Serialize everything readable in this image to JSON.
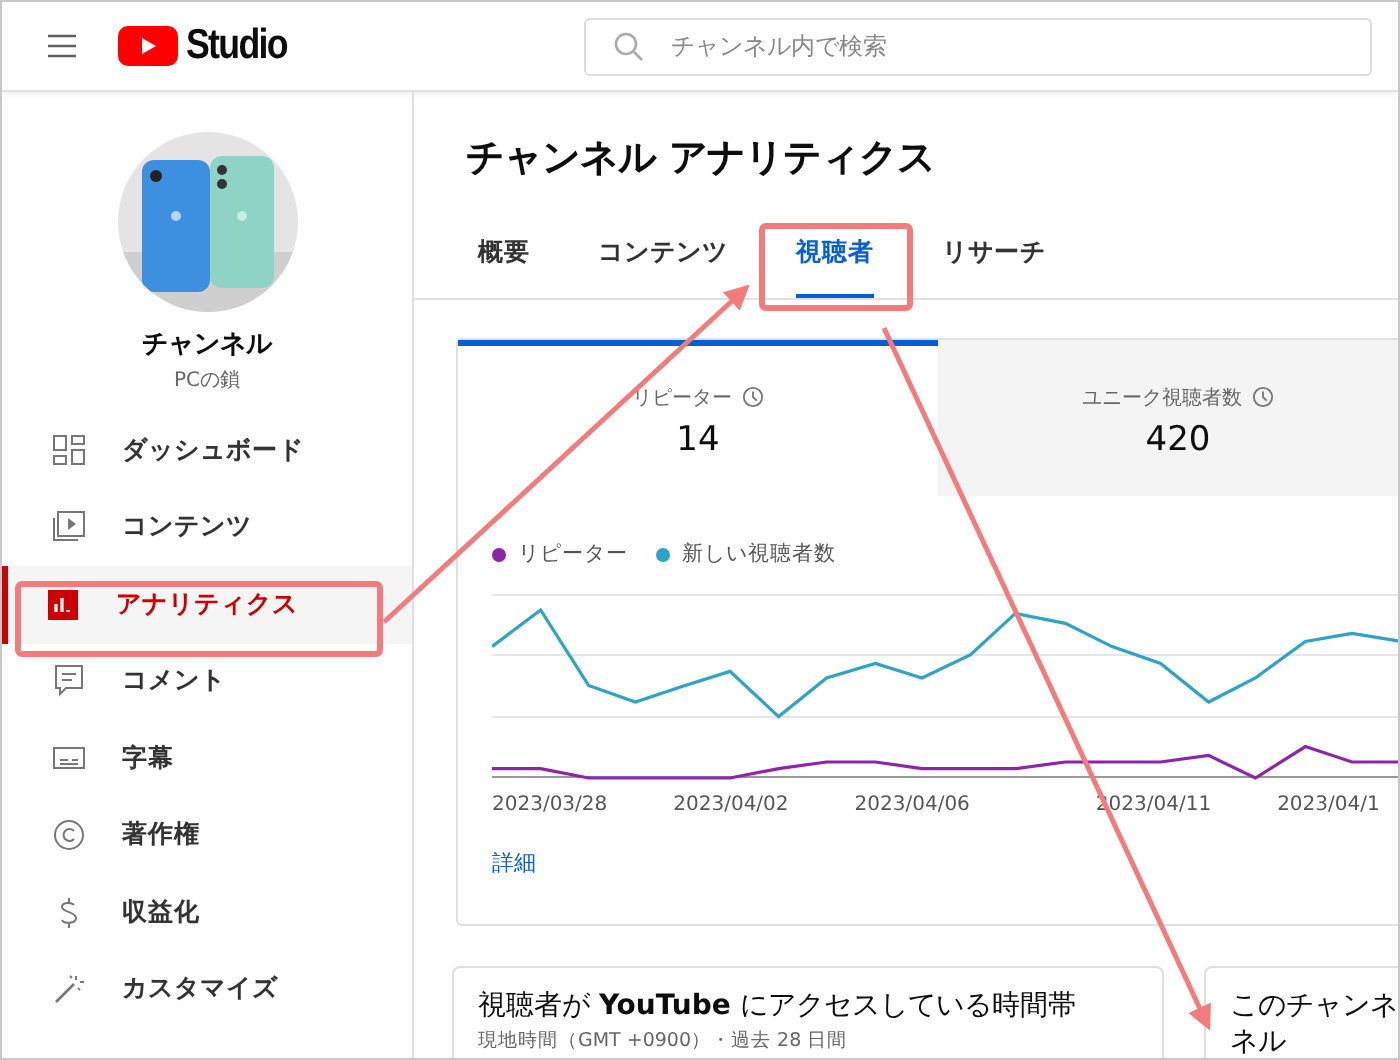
{
  "header": {
    "logo_text": "Studio",
    "search": {
      "placeholder": "チャンネル内で検索"
    }
  },
  "channel": {
    "name": "チャンネル",
    "subtitle": "PCの鎖"
  },
  "sidebar": {
    "items": [
      {
        "label": "ダッシュボード",
        "selected": false
      },
      {
        "label": "コンテンツ",
        "selected": false
      },
      {
        "label": "アナリティクス",
        "selected": true
      },
      {
        "label": "コメント",
        "selected": false
      },
      {
        "label": "字幕",
        "selected": false
      },
      {
        "label": "著作権",
        "selected": false
      },
      {
        "label": "収益化",
        "selected": false
      },
      {
        "label": "カスタマイズ",
        "selected": false
      }
    ]
  },
  "page_title": "チャンネル アナリティクス",
  "tabs": [
    {
      "label": "概要",
      "selected": false
    },
    {
      "label": "コンテンツ",
      "selected": false
    },
    {
      "label": "視聴者",
      "selected": true
    },
    {
      "label": "リサーチ",
      "selected": false
    }
  ],
  "metrics": [
    {
      "label": "リピーター",
      "value": "14",
      "selected": true
    },
    {
      "label": "ユニーク視聴者数",
      "value": "420",
      "selected": false
    }
  ],
  "chart": {
    "legend": [
      {
        "name": "リピーター",
        "color": "#8e24aa"
      },
      {
        "name": "新しい視聴者数",
        "color": "#2fa3c4"
      }
    ],
    "x_labels": [
      "2023/03/28",
      "2023/04/02",
      "2023/04/06",
      "2023/04/11",
      "2023/04/1"
    ],
    "details_link": "詳細"
  },
  "cards": [
    {
      "title": "視聴者が **YouTube** にアクセスしている時間帯",
      "subtitle": "現地時間（GMT +0900）・過去 28 日間"
    },
    {
      "lines": [
        "このチャンネ",
        "ネル"
      ]
    }
  ]
}
